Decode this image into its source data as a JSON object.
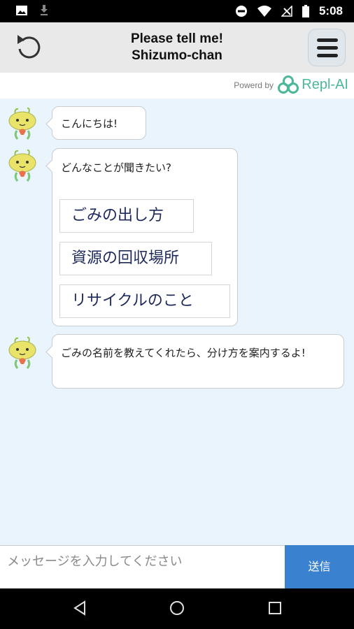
{
  "status_bar": {
    "time": "5:08"
  },
  "header": {
    "title_line1": "Please tell me!",
    "title_line2": "Shizumo-chan"
  },
  "powered": {
    "label": "Powerd by",
    "brand": "Repl-AI"
  },
  "messages": [
    {
      "text": "こんにちは!"
    },
    {
      "text": "どんなことが聞きたい?",
      "choices": [
        "ごみの出し方",
        "資源の回収場所",
        "リサイクルのこと"
      ]
    },
    {
      "text": "ごみの名前を教えてくれたら、分け方を案内するよ!"
    }
  ],
  "input": {
    "placeholder": "メッセージを入力してください"
  },
  "send": {
    "label": "送信"
  },
  "colors": {
    "accent": "#3a82cf",
    "brand": "#4cb89a",
    "chat_bg": "#eaf4fc"
  }
}
